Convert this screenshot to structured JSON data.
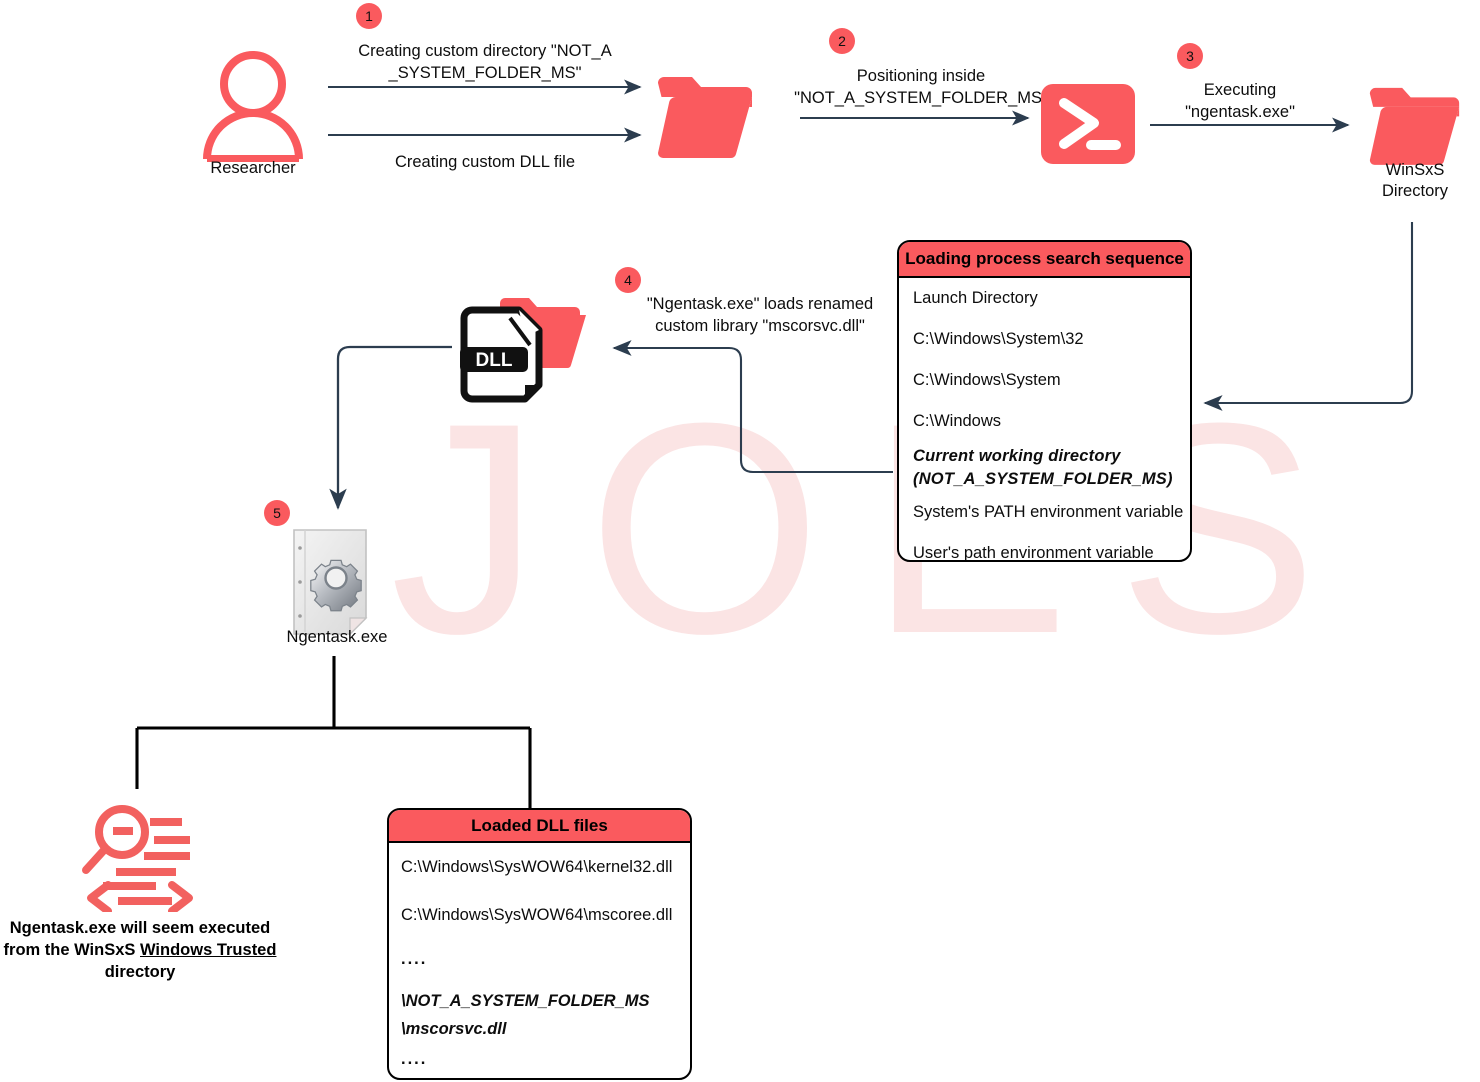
{
  "theme": {
    "accent_red": "#fa5a5e",
    "arrow_navy": "#2c3d4f",
    "connector_black": "#000000",
    "watermark_pink": "#fbe4e4",
    "background": "#ffffff"
  },
  "watermark": {
    "text": "JOES"
  },
  "steps": [
    {
      "number": "1"
    },
    {
      "number": "2"
    },
    {
      "number": "3"
    },
    {
      "number": "4"
    },
    {
      "number": "5"
    }
  ],
  "actors": {
    "researcher_label": "Researcher",
    "winsxs_label": "WinSxS\nDirectory",
    "ngentask_label": "Ngentask.exe"
  },
  "arrow_labels": {
    "create_directory": "Creating custom directory \"NOT_A\n_SYSTEM_FOLDER_MS\"",
    "create_dll": "Creating custom DLL file",
    "positioning": "Positioning inside\n\"NOT_A_SYSTEM_FOLDER_MS\"",
    "executing": "Executing\n\"ngentask.exe\"",
    "loads_library": "\"Ngentask.exe\" loads renamed\ncustom library \"mscorsvc.dll\""
  },
  "loading_panel": {
    "title": "Loading process search sequence",
    "rows": [
      {
        "text": "Launch Directory",
        "emphasis": false
      },
      {
        "text": "C:\\Windows\\System\\32",
        "emphasis": false
      },
      {
        "text": "C:\\Windows\\System",
        "emphasis": false
      },
      {
        "text": "C:\\Windows",
        "emphasis": false
      },
      {
        "text": "Current working directory\n(NOT_A_SYSTEM_FOLDER_MS)",
        "emphasis": true
      },
      {
        "text": "System's PATH environment variable",
        "emphasis": false
      },
      {
        "text": "User's path environment variable",
        "emphasis": false
      }
    ]
  },
  "dll_panel": {
    "title": "Loaded DLL files",
    "rows": [
      {
        "text": "C:\\Windows\\SysWOW64\\kernel32.dll",
        "emphasis": false
      },
      {
        "text": "C:\\Windows\\SysWOW64\\mscoree.dll",
        "emphasis": false
      },
      {
        "text": "....",
        "emphasis": false
      },
      {
        "text": "\\NOT_A_SYSTEM_FOLDER_MS\n\\mscorsvc.dll",
        "emphasis": true
      },
      {
        "text": "....",
        "emphasis": false
      }
    ]
  },
  "conclusion": {
    "line1": "Ngentask.exe will seem executed",
    "line2_pre": "from the WinSxS ",
    "line2_underlined": "Windows Trusted",
    "line3": "directory"
  },
  "icons": {
    "folder": "folder-icon",
    "powershell": "powershell-icon",
    "dll_file": "dll-file-icon",
    "researcher": "person-icon",
    "exe": "exe-gear-icon",
    "audit": "magnifier-log-icon"
  }
}
